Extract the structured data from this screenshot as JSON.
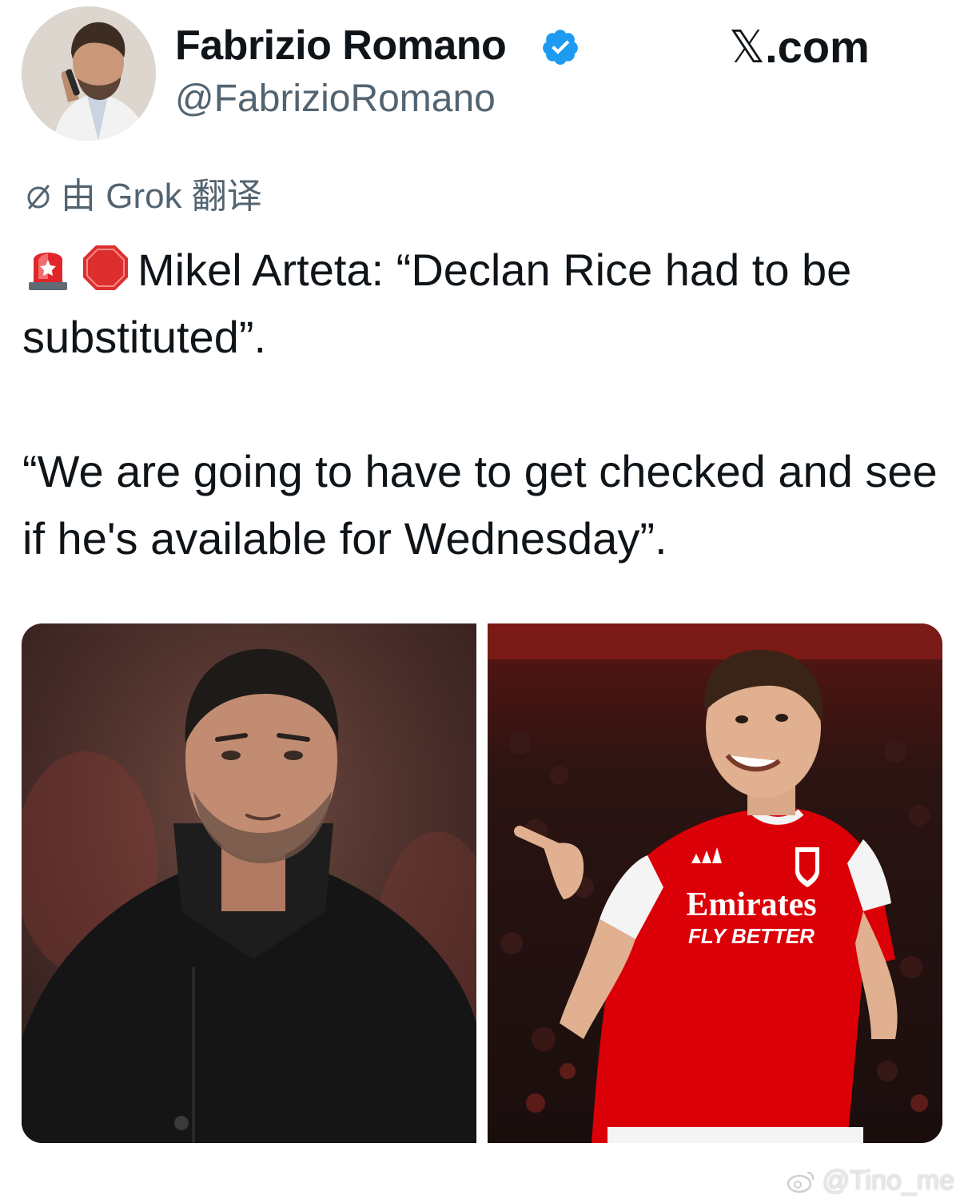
{
  "author": {
    "name": "Fabrizio Romano",
    "handle": "@FabrizioRomano",
    "verified": true,
    "verified_color": "#1d9bf0"
  },
  "brand": {
    "x_mark": "𝕏",
    "domain": ".com"
  },
  "translation": {
    "label": "由 Grok 翻译",
    "icon": "translate-slash-icon"
  },
  "tweet": {
    "emojis": [
      "rotating-light-icon",
      "stop-sign-icon"
    ],
    "line1": "Mikel Arteta: “Declan Rice had to be substituted”.",
    "line2": "“We are going to have to get checked and see if he's available for Wednesday”."
  },
  "media": {
    "photos": [
      {
        "subject": "arteta-photo"
      },
      {
        "subject": "rice-photo",
        "shirt_sponsor": "Emirates",
        "shirt_tagline": "FLY BETTER"
      }
    ]
  },
  "watermark": {
    "text": "@Tino_me",
    "icon": "weibo-icon"
  },
  "colors": {
    "text": "#0f1419",
    "secondary": "#536471",
    "arsenal_red": "#db0007"
  }
}
